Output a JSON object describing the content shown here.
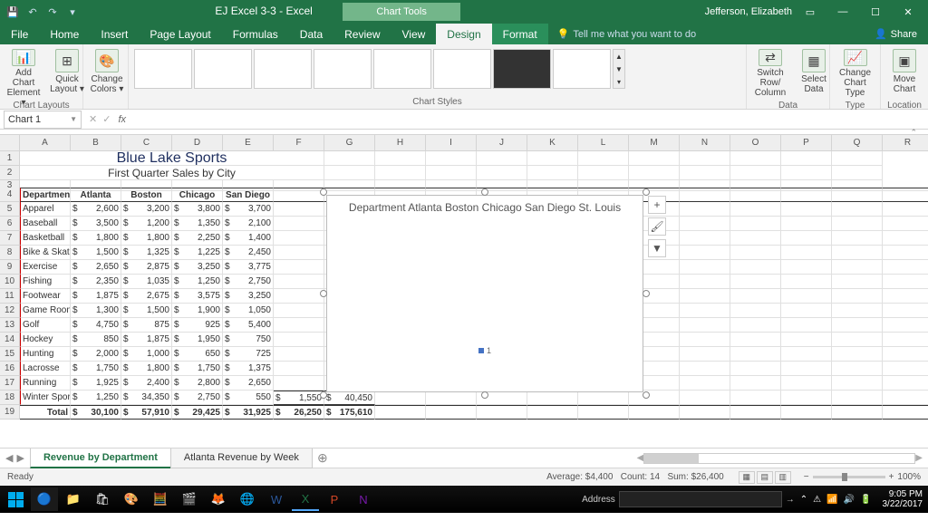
{
  "window": {
    "title": "EJ Excel 3-3  -  Excel",
    "context_tab": "Chart Tools",
    "user": "Jefferson, Elizabeth"
  },
  "ribbon_tabs": [
    "File",
    "Home",
    "Insert",
    "Page Layout",
    "Formulas",
    "Data",
    "Review",
    "View",
    "Design",
    "Format"
  ],
  "active_ribbon_tab": "Design",
  "tell_me": "Tell me what you want to do",
  "share": "Share",
  "ribbon_groups": {
    "chart_layouts": {
      "label": "Chart Layouts",
      "add_element": "Add Chart Element ▾",
      "quick_layout": "Quick Layout ▾"
    },
    "change_colors": {
      "label": "Change Colors ▾"
    },
    "chart_styles": {
      "label": "Chart Styles"
    },
    "data": {
      "label": "Data",
      "switch": "Switch Row/ Column",
      "select": "Select Data"
    },
    "type": {
      "label": "Type",
      "change": "Change Chart Type"
    },
    "location": {
      "label": "Location",
      "move": "Move Chart"
    }
  },
  "namebox": "Chart 1",
  "sheet": {
    "title": "Blue Lake Sports",
    "subtitle": "First Quarter Sales by City",
    "headers": [
      "Department",
      "Atlanta",
      "Boston",
      "Chicago",
      "San Diego"
    ],
    "rows": [
      [
        "Apparel",
        "2,600",
        "3,200",
        "3,800",
        "3,700"
      ],
      [
        "Baseball",
        "3,500",
        "1,200",
        "1,350",
        "2,100"
      ],
      [
        "Basketball",
        "1,800",
        "1,800",
        "2,250",
        "1,400"
      ],
      [
        "Bike & Skate",
        "1,500",
        "1,325",
        "1,225",
        "2,450"
      ],
      [
        "Exercise",
        "2,650",
        "2,875",
        "3,250",
        "3,775"
      ],
      [
        "Fishing",
        "2,350",
        "1,035",
        "1,250",
        "2,750"
      ],
      [
        "Footwear",
        "1,875",
        "2,675",
        "3,575",
        "3,250"
      ],
      [
        "Game Room",
        "1,300",
        "1,500",
        "1,900",
        "1,050"
      ],
      [
        "Golf",
        "4,750",
        "875",
        "925",
        "5,400"
      ],
      [
        "Hockey",
        "850",
        "1,875",
        "1,950",
        "750"
      ],
      [
        "Hunting",
        "2,000",
        "1,000",
        "650",
        "725"
      ],
      [
        "Lacrosse",
        "1,750",
        "1,800",
        "1,750",
        "1,375"
      ],
      [
        "Running",
        "1,925",
        "2,400",
        "2,800",
        "2,650"
      ],
      [
        "Winter Sports",
        "1,250",
        "34,350",
        "2,750",
        "550"
      ]
    ],
    "total_label": "Total",
    "totals": [
      "30,100",
      "57,910",
      "29,425",
      "31,925",
      "26,250",
      "175,610"
    ],
    "extra_row18": [
      "1,550",
      "40,450"
    ]
  },
  "chart": {
    "title": "Department Atlanta Boston Chicago San Diego St. Louis",
    "legend": "1"
  },
  "sheet_tabs": {
    "active": "Revenue by Department",
    "others": [
      "Atlanta Revenue by Week"
    ]
  },
  "statusbar": {
    "ready": "Ready",
    "avg_label": "Average:",
    "avg": "$4,400",
    "count_label": "Count:",
    "count": "14",
    "sum_label": "Sum:",
    "sum": "$26,400",
    "zoom": "100%"
  },
  "taskbar": {
    "address_label": "Address",
    "time": "9:05 PM",
    "date": "3/22/2017"
  },
  "chart_data": {
    "type": "bar",
    "categories": [
      "Atlanta",
      "Boston",
      "Chicago",
      "San Diego"
    ],
    "series": [
      {
        "name": "Apparel",
        "values": [
          2600,
          3200,
          3800,
          3700
        ]
      },
      {
        "name": "Baseball",
        "values": [
          3500,
          1200,
          1350,
          2100
        ]
      },
      {
        "name": "Basketball",
        "values": [
          1800,
          1800,
          2250,
          1400
        ]
      },
      {
        "name": "Bike & Skate",
        "values": [
          1500,
          1325,
          1225,
          2450
        ]
      },
      {
        "name": "Exercise",
        "values": [
          2650,
          2875,
          3250,
          3775
        ]
      },
      {
        "name": "Fishing",
        "values": [
          2350,
          1035,
          1250,
          2750
        ]
      },
      {
        "name": "Footwear",
        "values": [
          1875,
          2675,
          3575,
          3250
        ]
      },
      {
        "name": "Game Room",
        "values": [
          1300,
          1500,
          1900,
          1050
        ]
      },
      {
        "name": "Golf",
        "values": [
          4750,
          875,
          925,
          5400
        ]
      },
      {
        "name": "Hockey",
        "values": [
          850,
          1875,
          1950,
          750
        ]
      },
      {
        "name": "Hunting",
        "values": [
          2000,
          1000,
          650,
          725
        ]
      },
      {
        "name": "Lacrosse",
        "values": [
          1750,
          1800,
          1750,
          1375
        ]
      },
      {
        "name": "Running",
        "values": [
          1925,
          2400,
          2800,
          2650
        ]
      },
      {
        "name": "Winter Sports",
        "values": [
          1250,
          34350,
          2750,
          550
        ]
      }
    ],
    "title": "Department Atlanta Boston Chicago San Diego St. Louis"
  }
}
